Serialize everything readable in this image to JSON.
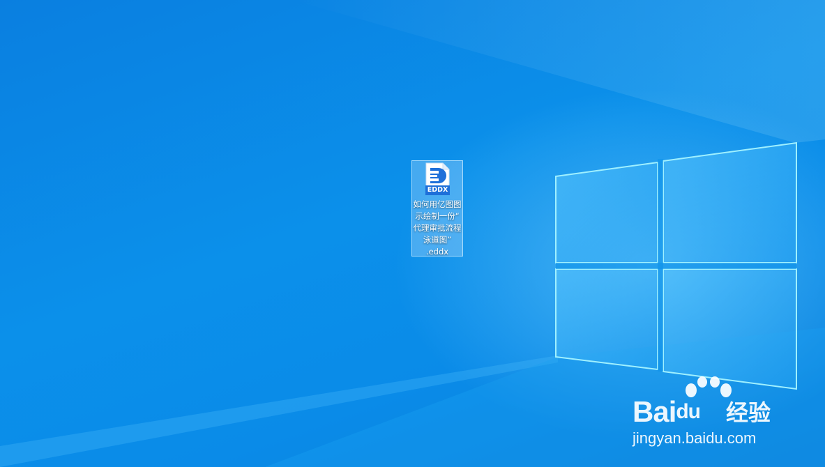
{
  "desktop": {
    "file_icon": {
      "badge_text": "EDDX",
      "label_lines": [
        "如何用亿图图",
        "示绘制一份“",
        "代理审批流程",
        "泳道图”",
        ".eddx"
      ],
      "icon_name": "eddx-file-icon",
      "accent_color": "#1e6fd9"
    }
  },
  "watermark": {
    "brand_prefix": "Bai",
    "brand_suffix": "du",
    "brand_cn": "经验",
    "url": "jingyan.baidu.com"
  },
  "colors": {
    "desktop_blue": "#0a86e6",
    "window_glow": "#7fe3ff"
  }
}
